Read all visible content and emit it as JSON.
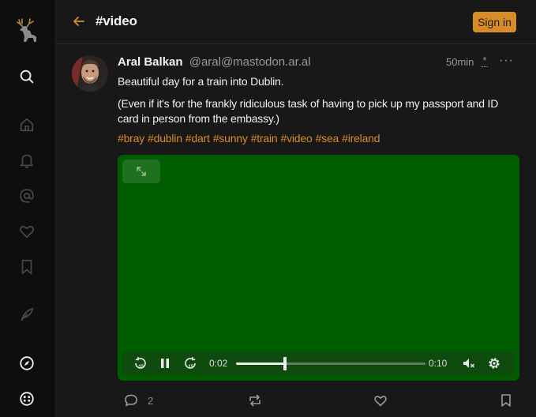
{
  "header": {
    "title": "#video",
    "signin_label": "Sign in"
  },
  "sidebar": {
    "items": [
      {
        "icon": "search-icon",
        "label": "Search"
      },
      {
        "icon": "home-icon",
        "label": "Home"
      },
      {
        "icon": "bell-icon",
        "label": "Notifications"
      },
      {
        "icon": "at-icon",
        "label": "Mentions"
      },
      {
        "icon": "heart-icon",
        "label": "Favourites"
      },
      {
        "icon": "bookmark-icon",
        "label": "Bookmarks"
      },
      {
        "icon": "compose-icon",
        "label": "Compose"
      },
      {
        "icon": "compass-icon",
        "label": "Explore"
      },
      {
        "icon": "settings-icon",
        "label": "Settings"
      }
    ]
  },
  "post": {
    "author_name": "Aral Balkan",
    "author_handle": "@aral@mastodon.ar.al",
    "time": "50min",
    "visibility": "*",
    "more": "···",
    "paragraph1": "Beautiful day for a train into Dublin.",
    "paragraph2": "(Even if it's for the frankly ridiculous task of having to pick up my passport and ID card in person from the embassy.)",
    "hashtags": [
      "#bray",
      "#dublin",
      "#dart",
      "#sunny",
      "#train",
      "#video",
      "#sea",
      "#ireland"
    ],
    "video": {
      "current_time": "0:02",
      "duration": "0:10",
      "progress_fraction": 0.2,
      "muted": true
    },
    "replies_count": "2"
  },
  "colors": {
    "accent": "#d88c28",
    "video_bg": "#005d00",
    "controls_bg": "#0f4a0f"
  }
}
